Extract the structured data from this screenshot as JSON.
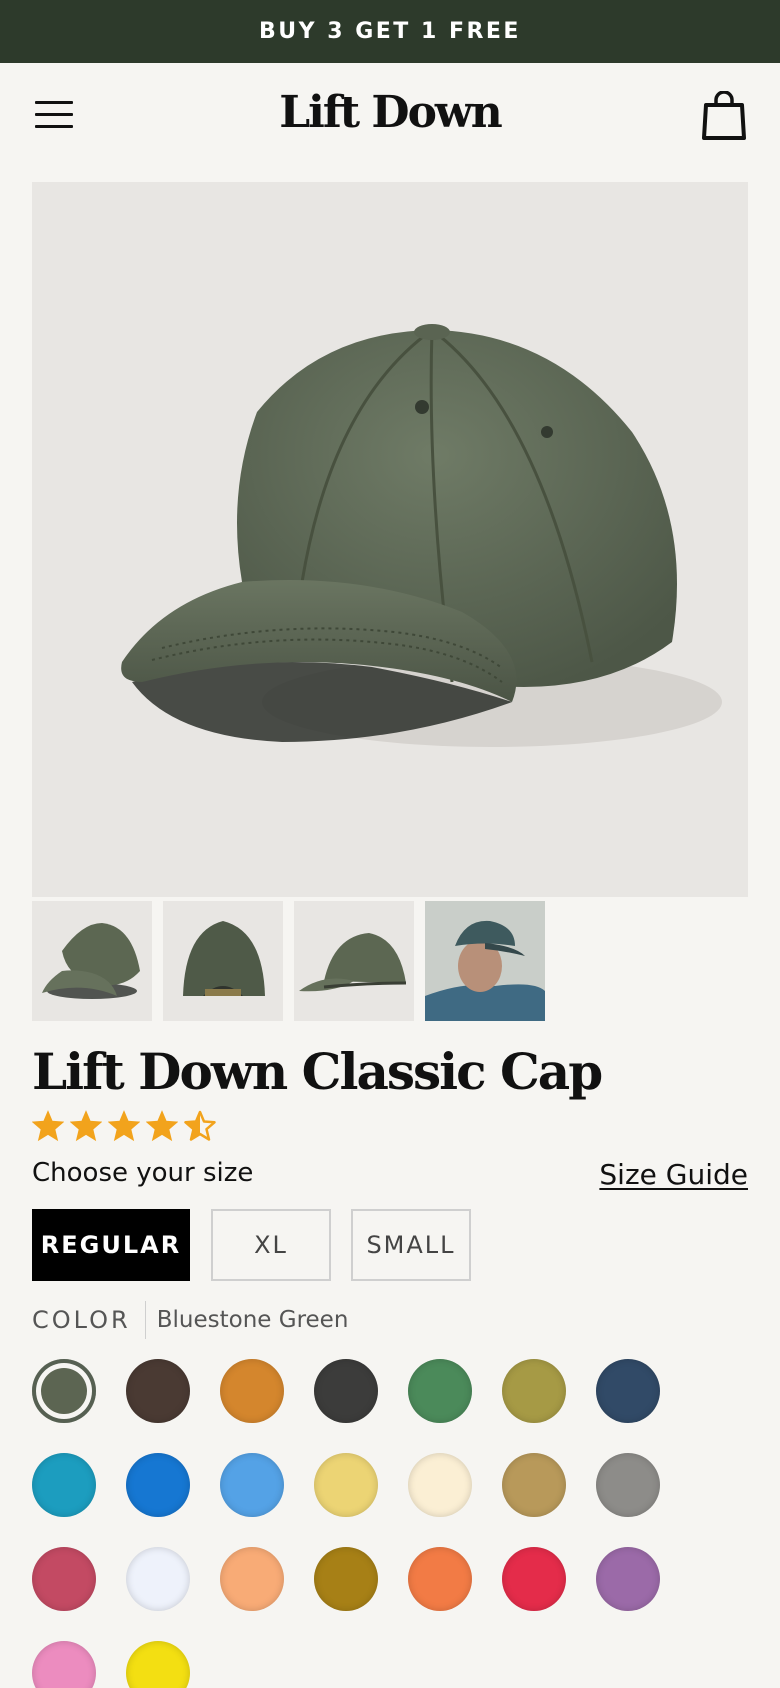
{
  "promo": {
    "text": "BUY 3 GET 1 FREE"
  },
  "header": {
    "logo": "Lift Down",
    "menu_icon": "hamburger-menu-icon",
    "cart_icon": "shopping-bag-icon"
  },
  "gallery": {
    "main_image": "green-washed-cap-photo",
    "thumbnails": [
      "cap-front-three-quarter",
      "cap-back",
      "cap-side",
      "man-wearing-cap"
    ],
    "active_index": 0
  },
  "product": {
    "title": "Lift Down Classic Cap",
    "rating": 4.5,
    "rating_max": 5
  },
  "size": {
    "label": "Choose your size",
    "guide_link": "Size Guide",
    "options": [
      "REGULAR",
      "XL",
      "SMALL"
    ],
    "selected": "REGULAR"
  },
  "color": {
    "label": "COLOR",
    "selected_name": "Bluestone Green",
    "swatches": [
      "#5c6552",
      "#4a3a33",
      "#d4862d",
      "#3c3c3b",
      "#4b8a5a",
      "#a69a45",
      "#314a67",
      "#1c9dbf",
      "#1677d2",
      "#54a2e6",
      "#ecd474",
      "#fbefd4",
      "#b8995a",
      "#8d8c89",
      "#c34a63",
      "#eef2fb",
      "#f8ab76",
      "#a78016",
      "#f27b45",
      "#e42c4a",
      "#9b6aa8",
      "#ec8cbf",
      "#f3df12"
    ]
  },
  "colors": {
    "promo_bg": "#2d3a2b",
    "page_bg": "#f6f5f2",
    "star": "#f2a31c"
  }
}
